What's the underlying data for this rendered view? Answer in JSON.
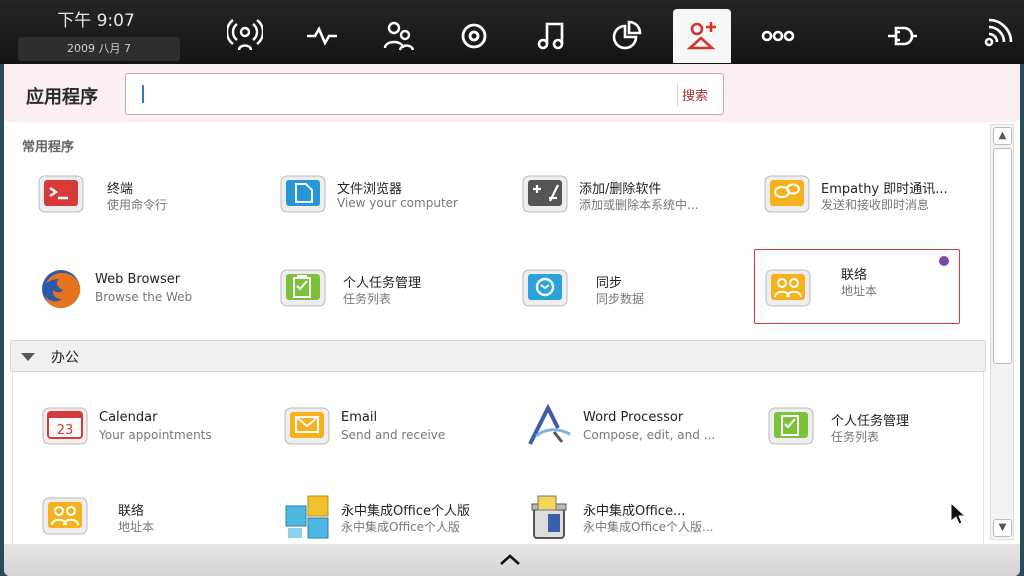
{
  "clock": {
    "time": "下午 9:07",
    "date": "2009 八月 7"
  },
  "toolbar": {
    "icons": [
      "status-icon",
      "activity-icon",
      "people-icon",
      "media-icon",
      "music-icon",
      "pie-icon",
      "applications-icon",
      "apps-grid-icon",
      "devices-icon",
      "wireless-icon"
    ]
  },
  "header": {
    "title": "应用程序",
    "search_placeholder": "",
    "search_button": "搜索"
  },
  "frequent": {
    "title": "常用程序",
    "apps": [
      {
        "name": "终端",
        "desc": "使用命令行",
        "icon": "terminal-icon"
      },
      {
        "name": "文件浏览器",
        "desc": "View your computer",
        "icon": "file-browser-icon"
      },
      {
        "name": "添加/删除软件",
        "desc": "添加或删除本系统中...",
        "icon": "add-remove-icon"
      },
      {
        "name": "Empathy 即时通讯...",
        "desc": "发送和接收即时消息",
        "icon": "chat-icon"
      },
      {
        "name": "Web Browser",
        "desc": "Browse the Web",
        "icon": "firefox-icon"
      },
      {
        "name": "个人任务管理",
        "desc": "任务列表",
        "icon": "tasks-icon"
      },
      {
        "name": "同步",
        "desc": "同步数据",
        "icon": "sync-icon"
      },
      {
        "name": "联络",
        "desc": "地址本",
        "icon": "contacts-icon"
      }
    ]
  },
  "office": {
    "title": "办公",
    "apps": [
      {
        "name": "Calendar",
        "desc": "Your appointments",
        "icon": "calendar-icon",
        "date": "23"
      },
      {
        "name": "Email",
        "desc": "Send and receive",
        "icon": "email-icon"
      },
      {
        "name": "Word Processor",
        "desc": "Compose, edit, and ...",
        "icon": "word-processor-icon"
      },
      {
        "name": "个人任务管理",
        "desc": "任务列表",
        "icon": "tasks-icon"
      },
      {
        "name": "联络",
        "desc": "地址本",
        "icon": "contacts-icon"
      },
      {
        "name": "永中集成Office个人版",
        "desc": "永中集成Office个人版",
        "icon": "office-suite-icon"
      },
      {
        "name": "永中集成Office...",
        "desc": "永中集成Office个人版...",
        "icon": "office-cleaner-icon"
      }
    ]
  }
}
